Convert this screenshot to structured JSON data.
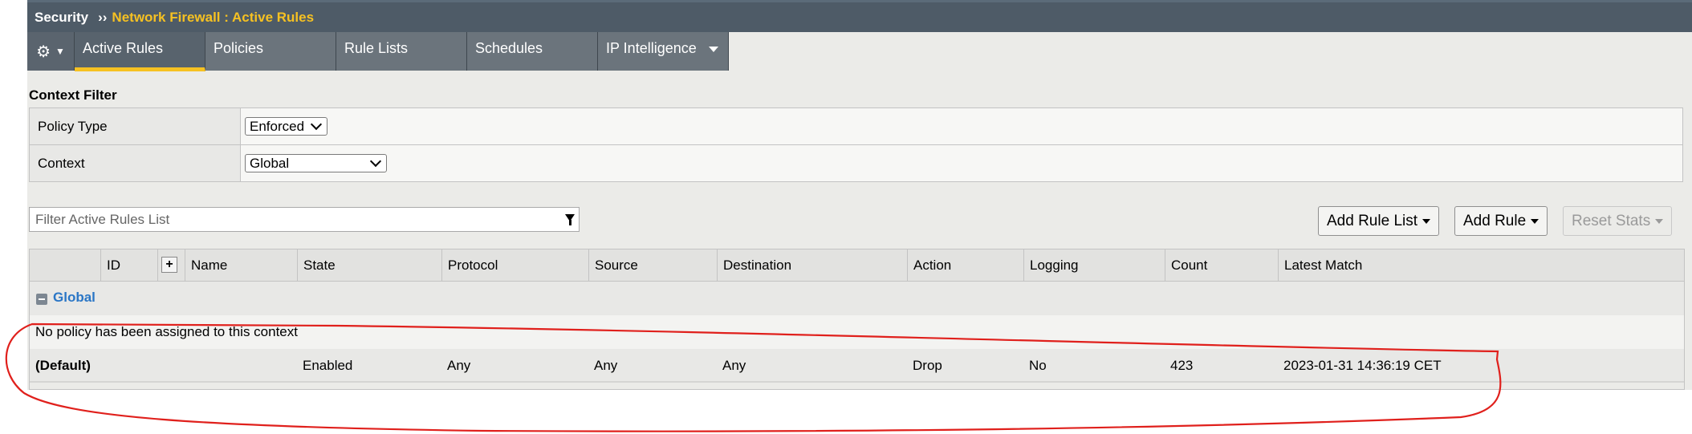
{
  "breadcrumb": {
    "section": "Security",
    "separator": "››",
    "page": "Network Firewall : Active Rules"
  },
  "tabs": {
    "gear_icon": "gear-icon",
    "items": [
      "Active Rules",
      "Policies",
      "Rule Lists",
      "Schedules",
      "IP Intelligence"
    ],
    "active": "Active Rules"
  },
  "context_filter": {
    "title": "Context Filter",
    "policy_type_label": "Policy Type",
    "policy_type_value": "Enforced",
    "context_label": "Context",
    "context_value": "Global"
  },
  "filter": {
    "placeholder": "Filter Active Rules List"
  },
  "buttons": {
    "add_rule_list": "Add Rule List",
    "add_rule": "Add Rule",
    "reset_stats": "Reset Stats"
  },
  "table": {
    "columns": [
      "ID",
      "Name",
      "State",
      "Protocol",
      "Source",
      "Destination",
      "Action",
      "Logging",
      "Count",
      "Latest Match"
    ],
    "group": "Global",
    "message": "No policy has been assigned to this context",
    "rows": [
      {
        "name": "(Default)",
        "state": "Enabled",
        "protocol": "Any",
        "source": "Any",
        "destination": "Any",
        "action": "Drop",
        "logging": "No",
        "count": "423",
        "latest_match": "2023-01-31 14:36:19 CET"
      }
    ]
  },
  "colors": {
    "header_bg": "#4e5b67",
    "accent": "#f6c122",
    "group_link": "#2a76c6",
    "annotation": "#e0201c"
  }
}
